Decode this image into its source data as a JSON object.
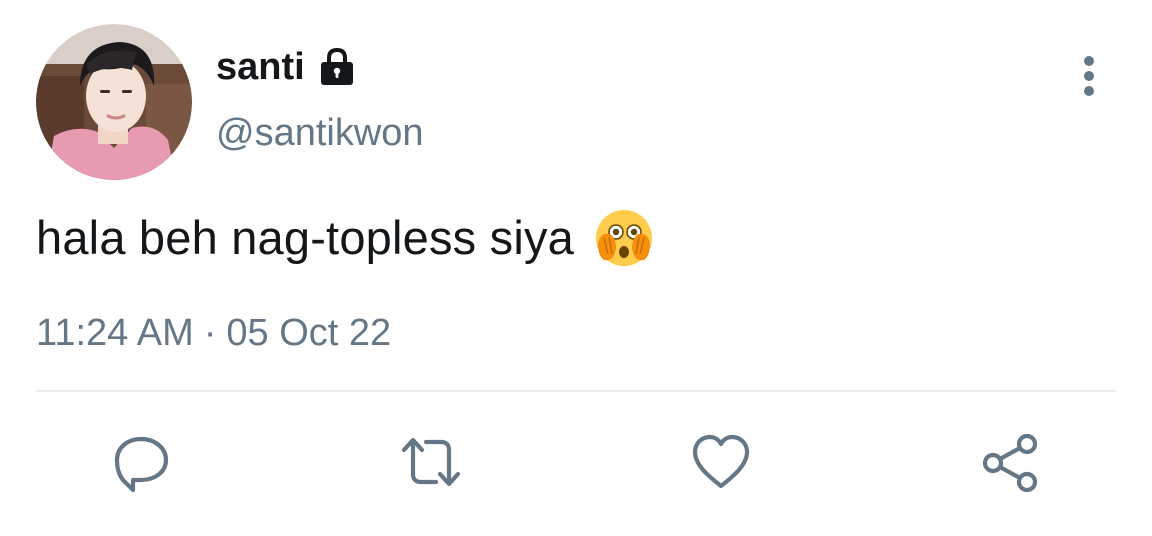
{
  "tweet": {
    "display_name": "santi",
    "handle": "@santikwon",
    "text": "hala beh nag-topless siya",
    "emoji": "face-with-open-eyes-and-hand-over-mouth",
    "time": "11:24 AM",
    "separator": "·",
    "date": "05 Oct 22",
    "protected": true
  },
  "icons": {
    "lock": "lock-icon",
    "more": "vertical-ellipsis-icon",
    "reply": "comment-bubble-icon",
    "retweet": "retweet-icon",
    "like": "heart-icon",
    "share": "share-icon"
  },
  "colors": {
    "text_primary": "#14171a",
    "text_secondary": "#657786",
    "divider": "#e6ecf0",
    "icon": "#657786"
  }
}
